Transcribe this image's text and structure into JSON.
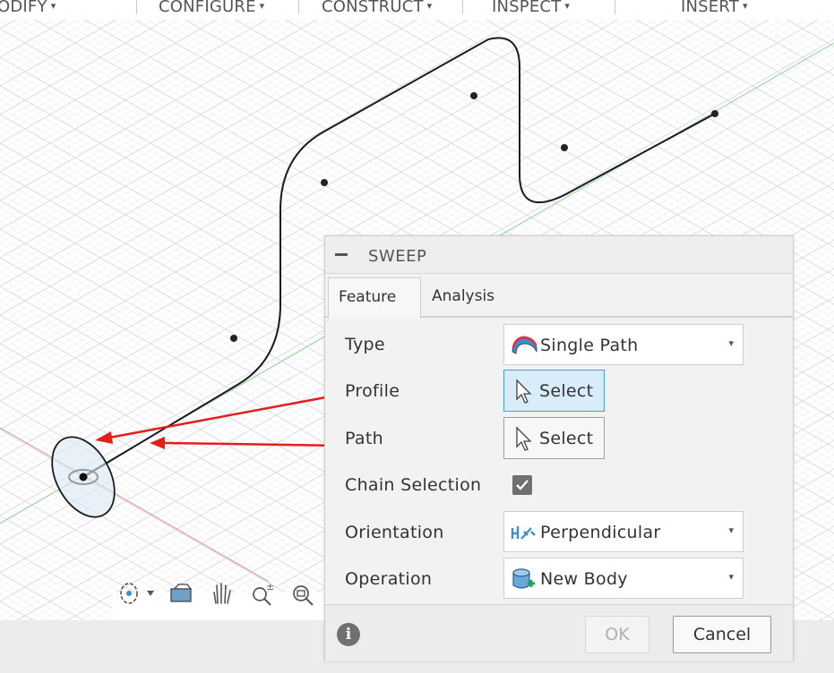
{
  "toolbar": {
    "menus": [
      {
        "label": "ODIFY"
      },
      {
        "label": "CONFIGURE"
      },
      {
        "label": "CONSTRUCT"
      },
      {
        "label": "INSPECT"
      },
      {
        "label": "INSERT"
      }
    ],
    "dropdown_arrow": "▾"
  },
  "dialog": {
    "title": "SWEEP",
    "tabs": [
      {
        "label": "Feature",
        "active": true
      },
      {
        "label": "Analysis",
        "active": false
      }
    ],
    "rows": {
      "type": {
        "label": "Type",
        "value": "Single Path",
        "icon": "single-path-icon"
      },
      "profile": {
        "label": "Profile",
        "button": "Select",
        "active": true
      },
      "path": {
        "label": "Path",
        "button": "Select",
        "active": false
      },
      "chain_selection": {
        "label": "Chain Selection",
        "checked": true
      },
      "orientation": {
        "label": "Orientation",
        "value": "Perpendicular",
        "icon": "perpendicular-icon"
      },
      "operation": {
        "label": "Operation",
        "value": "New Body",
        "icon": "new-body-icon"
      }
    },
    "footer": {
      "ok_label": "OK",
      "cancel_label": "Cancel",
      "info_symbol": "i"
    }
  },
  "colors": {
    "accent_blue": "#4a9ad4",
    "annotation_red": "#e0201a",
    "grid": "#d9dfe6"
  },
  "navbar_icons": [
    "orbit-icon",
    "look-at-icon",
    "pan-icon",
    "zoom-icon",
    "fit-icon"
  ]
}
